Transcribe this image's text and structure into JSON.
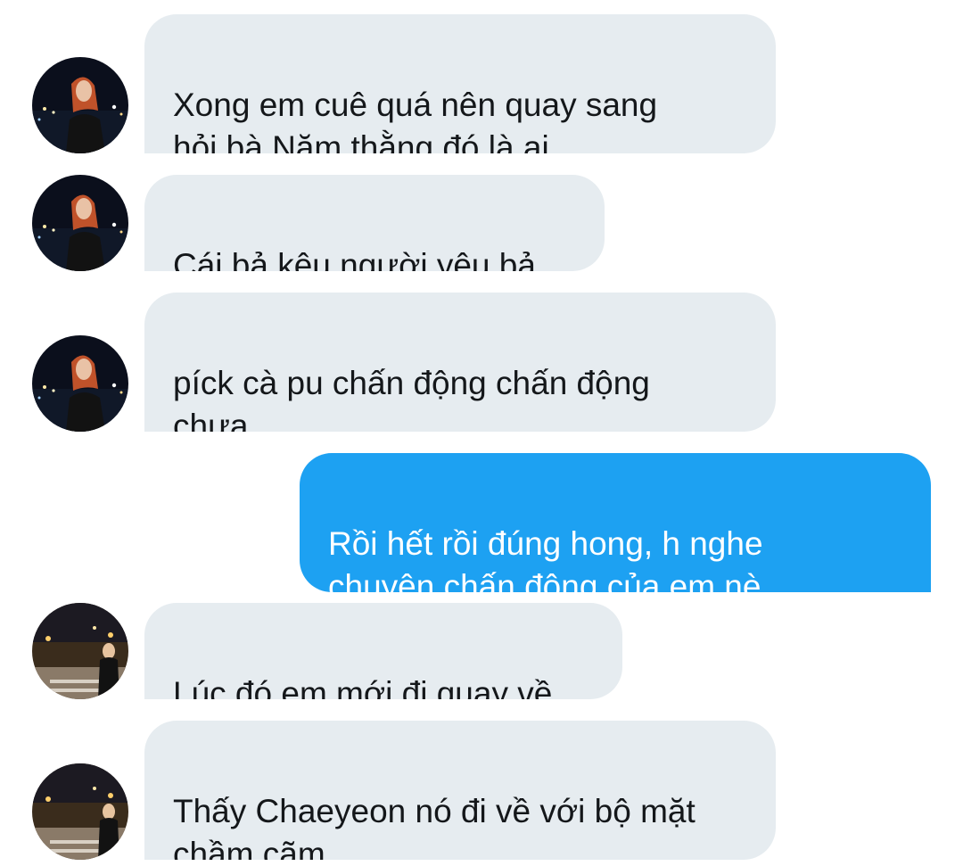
{
  "conversation": {
    "messages": [
      {
        "direction": "incoming",
        "avatar": "avatar-night-city",
        "text": "Xong em cuê quá nên quay sang\nhỏi bà Năm thằng đó là ai"
      },
      {
        "direction": "incoming",
        "avatar": "avatar-night-city",
        "text": "Cái bả kêu người yêu bả"
      },
      {
        "direction": "incoming",
        "avatar": "avatar-night-city",
        "text": "píck cà pu chấn động chấn động\nchưa"
      },
      {
        "direction": "outgoing",
        "text": "Rồi hết rồi đúng hong, h nghe\nchuyện chấn động của em nè"
      },
      {
        "direction": "incoming",
        "avatar": "avatar-street-lights",
        "text": "Lúc đó em mới đi quay về"
      },
      {
        "direction": "incoming",
        "avatar": "avatar-street-lights",
        "text": "Thấy Chaeyeon nó đi về với bộ mặt\nchầm cãm"
      }
    ]
  },
  "colors": {
    "incoming_bubble": "#e6ecf0",
    "outgoing_bubble": "#1da1f2",
    "incoming_text": "#14171a",
    "outgoing_text": "#ffffff"
  }
}
